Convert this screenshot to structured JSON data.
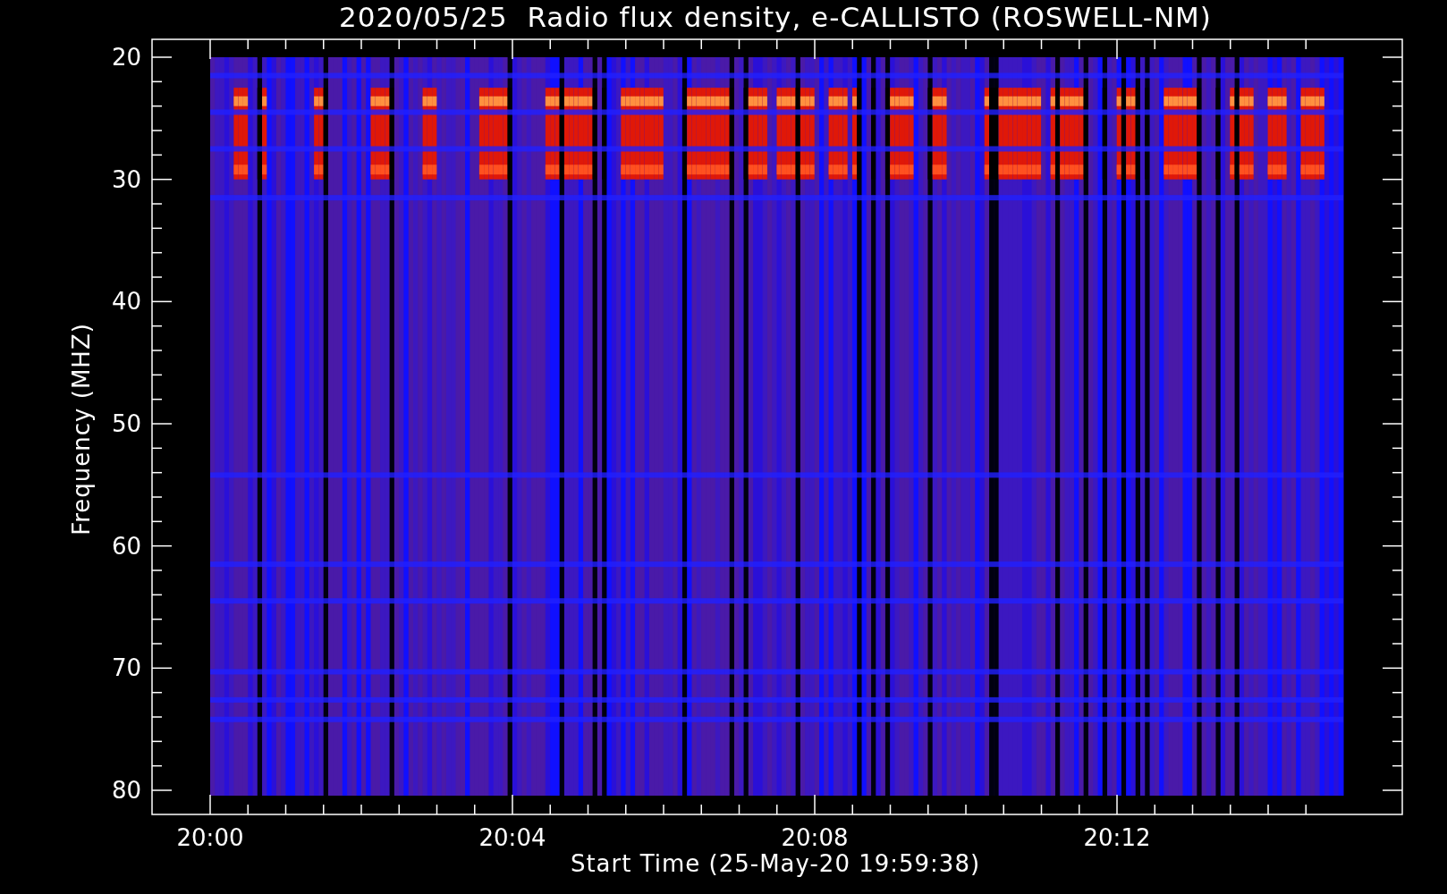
{
  "title": "2020/05/25  Radio flux density, e-CALLISTO (ROSWELL-NM)",
  "y_axis": {
    "label": "Frequency (MHZ)",
    "ticks": [
      "20",
      "30",
      "40",
      "50",
      "60",
      "70",
      "80"
    ]
  },
  "x_axis": {
    "label": "Start Time (25-May-20 19:59:38)",
    "ticks": [
      "20:00",
      "20:04",
      "20:08",
      "20:12"
    ]
  }
}
